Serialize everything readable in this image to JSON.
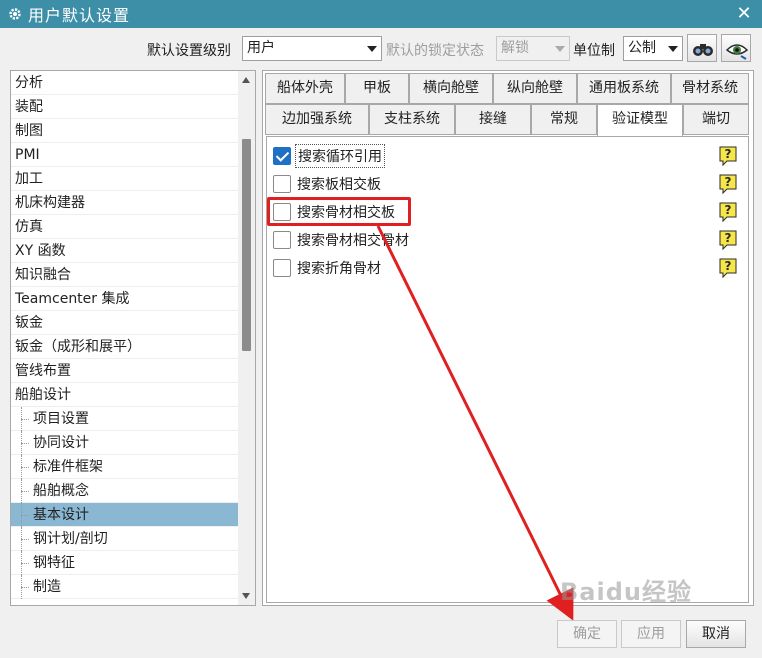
{
  "window": {
    "title": "用户默认设置",
    "close_glyph": "✕"
  },
  "toolbar": {
    "level_label": "默认设置级别",
    "level_value": "用户",
    "lock_label": "默认的锁定状态",
    "lock_value": "解锁",
    "unit_label": "单位制",
    "unit_value": "公制",
    "icons": [
      "binoculars-icon",
      "eye-icon"
    ]
  },
  "tree": {
    "items": [
      {
        "label": "分析",
        "level": 0
      },
      {
        "label": "装配",
        "level": 0
      },
      {
        "label": "制图",
        "level": 0
      },
      {
        "label": "PMI",
        "level": 0
      },
      {
        "label": "加工",
        "level": 0
      },
      {
        "label": "机床构建器",
        "level": 0
      },
      {
        "label": "仿真",
        "level": 0
      },
      {
        "label": "XY 函数",
        "level": 0
      },
      {
        "label": "知识融合",
        "level": 0
      },
      {
        "label": "Teamcenter 集成",
        "level": 0
      },
      {
        "label": "钣金",
        "level": 0
      },
      {
        "label": "钣金（成形和展平）",
        "level": 0
      },
      {
        "label": "管线布置",
        "level": 0
      },
      {
        "label": "船舶设计",
        "level": 0
      },
      {
        "label": "项目设置",
        "level": 1
      },
      {
        "label": "协同设计",
        "level": 1
      },
      {
        "label": "标准件框架",
        "level": 1
      },
      {
        "label": "船舶概念",
        "level": 1
      },
      {
        "label": "基本设计",
        "level": 1,
        "selected": true
      },
      {
        "label": "钢计划/剖切",
        "level": 1
      },
      {
        "label": "钢特征",
        "level": 1
      },
      {
        "label": "制造",
        "level": 1
      }
    ]
  },
  "tabs": {
    "row1": [
      "船体外壳",
      "甲板",
      "横向舱壁",
      "纵向舱壁",
      "通用板系统",
      "骨材系统"
    ],
    "row2": [
      "边加强系统",
      "支柱系统",
      "接缝",
      "常规",
      "验证模型",
      "端切"
    ],
    "active": "验证模型"
  },
  "options": [
    {
      "label": "搜索循环引用",
      "checked": true,
      "focused": true
    },
    {
      "label": "搜索板相交板",
      "checked": false
    },
    {
      "label": "搜索骨材相交板",
      "checked": false,
      "highlighted": true
    },
    {
      "label": "搜索骨材相交骨材",
      "checked": false
    },
    {
      "label": "搜索折角骨材",
      "checked": false
    }
  ],
  "buttons": {
    "ok": "确定",
    "apply": "应用",
    "cancel": "取消"
  },
  "watermark": "Baidu经验",
  "colors": {
    "titlebar": "#3d8fa8",
    "selected_row": "#8ab7d2",
    "checkbox_checked": "#1e70c4",
    "annotation_red": "#e02020"
  }
}
